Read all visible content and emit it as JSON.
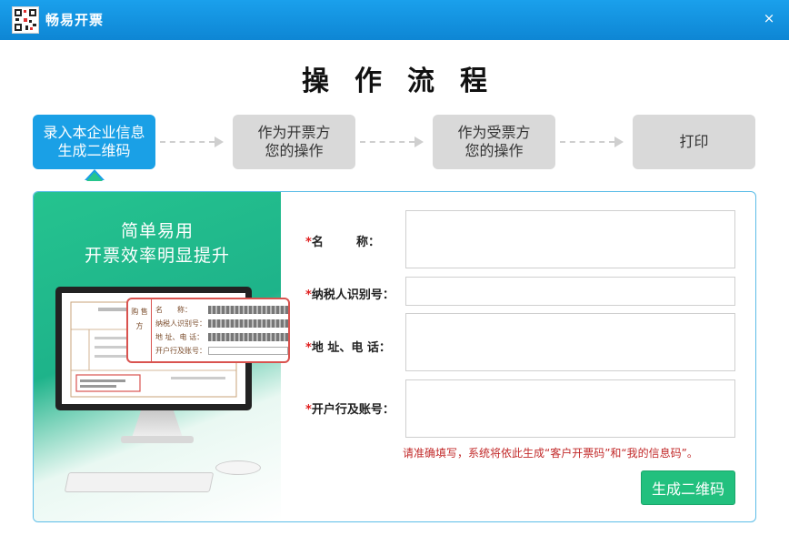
{
  "window": {
    "title": "畅易开票",
    "close_label": "×"
  },
  "heading": "操作流程",
  "steps": [
    {
      "line1": "录入本企业信息",
      "line2": "生成二维码",
      "active": true
    },
    {
      "line1": "作为开票方",
      "line2": "您的操作",
      "active": false
    },
    {
      "line1": "作为受票方",
      "line2": "您的操作",
      "active": false
    },
    {
      "line1": "打印",
      "line2": "",
      "active": false
    }
  ],
  "promo": {
    "line1": "简单易用",
    "line2": "开票效率明显提升",
    "zoom_side": "购 售 方",
    "zoom_labels": [
      "名　　称：",
      "纳税人识别号：",
      "地 址、电 话：",
      "开户行及账号："
    ]
  },
  "form": {
    "required_mark": "*",
    "fields": [
      {
        "label": "名        称：",
        "value": ""
      },
      {
        "label": "纳税人识别号：",
        "value": ""
      },
      {
        "label": "地 址、电 话：",
        "value": ""
      },
      {
        "label": "开户行及账号：",
        "value": ""
      }
    ],
    "hint": "请准确填写，系统将依此生成“客户开票码”和“我的信息码”。",
    "submit_label": "生成二维码"
  },
  "colors": {
    "title_bar": "#1aa0ec",
    "active_step": "#1aa0e6",
    "inactive_step": "#d9d9d9",
    "promo_green": "#25c38f",
    "button_green": "#22c07e",
    "hint_red": "#c22a2a",
    "required_red": "#e02020"
  }
}
